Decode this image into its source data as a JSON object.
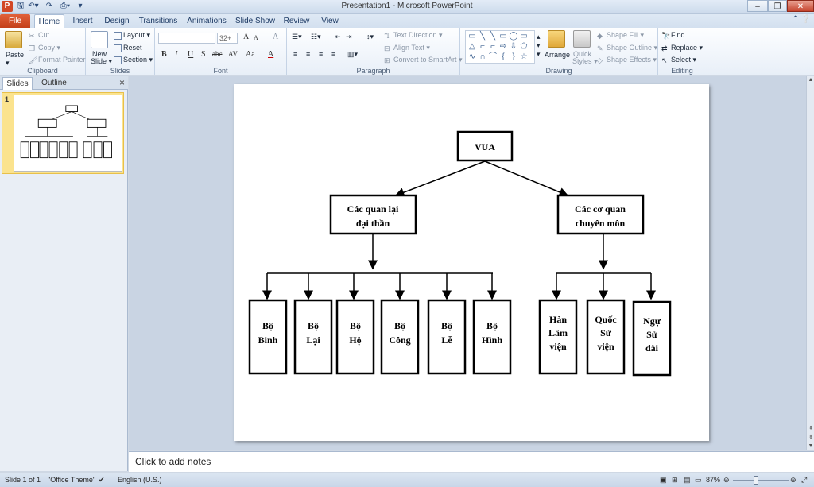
{
  "window": {
    "title": "Presentation1  -  Microsoft PowerPoint",
    "app_icon": "P",
    "controls": [
      "–",
      "❐",
      "✕"
    ]
  },
  "tabs": {
    "file": "File",
    "items": [
      "Home",
      "Insert",
      "Design",
      "Transitions",
      "Animations",
      "Slide Show",
      "Review",
      "View"
    ]
  },
  "ribbon": {
    "clipboard": {
      "paste": "Paste",
      "cut": "Cut",
      "copy": "Copy",
      "format_painter": "Format Painter",
      "label": "Clipboard"
    },
    "slides": {
      "new_slide": "New",
      "new_slide2": "Slide",
      "layout": "Layout",
      "reset": "Reset",
      "section": "Section",
      "label": "Slides"
    },
    "font": {
      "font_size": "32+",
      "bold": "B",
      "italic": "I",
      "underline": "U",
      "shadow": "S",
      "strike": "abc",
      "spacing": "AV",
      "case": "Aa",
      "color": "A",
      "grow": "A",
      "shrink": "A",
      "clear": "A",
      "label": "Font"
    },
    "paragraph": {
      "text_direction": "Text Direction",
      "align_text": "Align Text",
      "smartart": "Convert to SmartArt",
      "label": "Paragraph"
    },
    "drawing": {
      "arrange": "Arrange",
      "quick_styles": "Quick",
      "quick_styles2": "Styles",
      "shape_fill": "Shape Fill",
      "shape_outline": "Shape Outline",
      "shape_effects": "Shape Effects",
      "label": "Drawing"
    },
    "editing": {
      "find": "Find",
      "replace": "Replace",
      "select": "Select",
      "label": "Editing"
    }
  },
  "left_pane": {
    "tab_slides": "Slides",
    "tab_outline": "Outline",
    "close": "×",
    "slide_number": "1"
  },
  "slide": {
    "root": "VUA",
    "left_branch": [
      "Các quan lại",
      "đại thần"
    ],
    "right_branch": [
      "Các cơ quan",
      "chuyên môn"
    ],
    "left_children": [
      [
        "Bộ",
        "Binh"
      ],
      [
        "Bộ",
        "Lại"
      ],
      [
        "Bộ",
        "Hộ"
      ],
      [
        "Bộ",
        "Công"
      ],
      [
        "Bộ",
        "Lễ"
      ],
      [
        "Bộ",
        "Hình"
      ]
    ],
    "right_children": [
      [
        "Hàn",
        "Lâm",
        "viện"
      ],
      [
        "Quốc",
        "Sử",
        "viện"
      ],
      [
        "Ngự",
        "Sử",
        "đài"
      ]
    ]
  },
  "notes": {
    "placeholder": "Click to add notes"
  },
  "status": {
    "slide": "Slide 1 of 1",
    "theme": "\"Office Theme\"",
    "language": "English (U.S.)",
    "zoom": "87%"
  },
  "colors": {
    "file_tab": "#c4401b",
    "ribbon_bg": "#e8eff8",
    "thumb_selected": "#fbe38e"
  }
}
